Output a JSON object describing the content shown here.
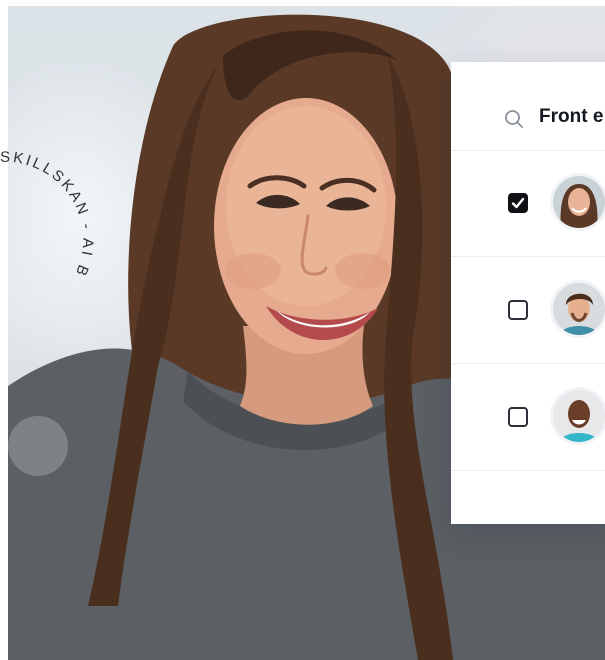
{
  "search": {
    "query_text": "Front e"
  },
  "badge": {
    "ring_text": "SKILLSKAN - AI BASED · SKILLSKAN - AI BASED · "
  },
  "candidates": [
    {
      "checked": true,
      "avatar": "woman-avatar"
    },
    {
      "checked": false,
      "avatar": "curly-hair-man-avatar"
    },
    {
      "checked": false,
      "avatar": "bald-man-avatar"
    }
  ],
  "colors": {
    "card_bg": "#ffffff",
    "checkbox_checked": "#0f1115",
    "text_primary": "#141821"
  }
}
